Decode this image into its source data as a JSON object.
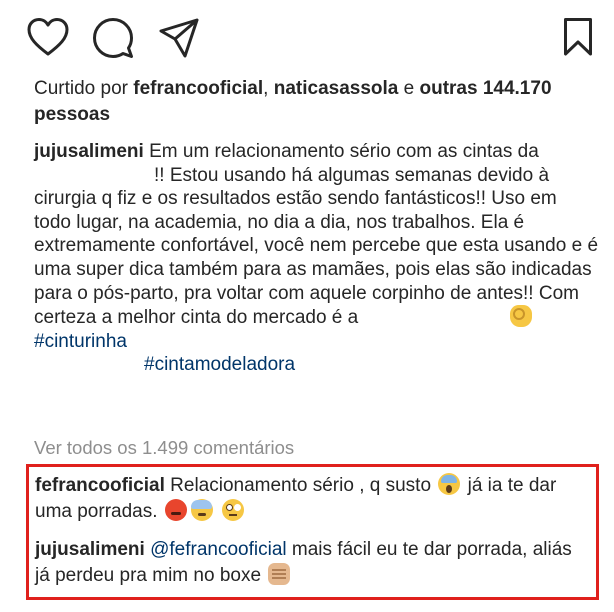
{
  "actions": {
    "like_icon": "heart-icon",
    "comment_icon": "comment-icon",
    "share_icon": "share-icon",
    "save_icon": "bookmark-icon"
  },
  "likes": {
    "prefix": "Curtido por ",
    "user1": "fefrancooficial",
    "sep": ", ",
    "user2": "naticasassola",
    "conj": " e ",
    "others": "outras 144.170 pessoas"
  },
  "caption": {
    "username": "jujusalimeni",
    "text1": "Em um relacionamento sério com as cintas da",
    "text2": "!! Estou usando há algumas semanas devido à cirurgia q fiz e os resultados estão sendo fantásticos!! Uso em todo lugar, na academia, no dia a dia, nos trabalhos. Ela é extremamente confortável, você nem percebe que esta usando e é uma super dica também para as mamães, pois elas são indicadas para o pós-parto, pra voltar com aquele corpinho de antes!! Com certeza a melhor cinta do mercado é a",
    "emoji": "ok-hand-emoji",
    "tag1": "#cinturinha",
    "tag2": "#cintamodeladora"
  },
  "view_all": "Ver todos os 1.499 comentários",
  "comments": [
    {
      "username": "fefrancooficial",
      "text_a": "Relacionamento sério , q susto",
      "text_b": "já ia te dar uma porradas.",
      "emojis": [
        "screaming-face-emoji",
        "angry-face-emoji",
        "sweat-face-emoji",
        "eye-roll-emoji"
      ]
    },
    {
      "username": "jujusalimeni",
      "mention": "@fefrancooficial",
      "text": "mais fácil eu te dar porrada, aliás já perdeu pra mim no boxe",
      "emojis": [
        "fist-emoji"
      ]
    }
  ],
  "colors": {
    "text": "#262626",
    "muted": "#8e8e8e",
    "hashtag": "#003569",
    "highlight_box": "#e0201c"
  }
}
